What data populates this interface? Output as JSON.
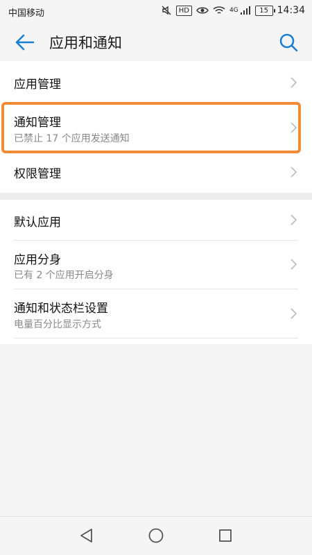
{
  "status_bar": {
    "carrier": "中国移动",
    "hd_badge": "HD",
    "network": "4G",
    "battery": "15",
    "time": "14:34",
    "icons": [
      "mute-icon",
      "eye-icon",
      "wifi-icon",
      "signal-icon"
    ]
  },
  "app_bar": {
    "title": "应用和通知",
    "back_icon": "arrow-left-icon",
    "search_icon": "search-icon",
    "accent": "#1a7fd4"
  },
  "section1": {
    "items": [
      {
        "label": "应用管理"
      },
      {
        "label": "通知管理",
        "sub": "已禁止 17 个应用发送通知"
      },
      {
        "label": "权限管理"
      }
    ]
  },
  "section2": {
    "items": [
      {
        "label": "默认应用"
      },
      {
        "label": "应用分身",
        "sub": "已有 2 个应用开启分身"
      },
      {
        "label": "通知和状态栏设置",
        "sub": "电量百分比显示方式"
      }
    ]
  },
  "highlight_color": "#f28c36",
  "nav_bar": {
    "icons": [
      "back-triangle-icon",
      "home-circle-icon",
      "recents-square-icon"
    ]
  }
}
